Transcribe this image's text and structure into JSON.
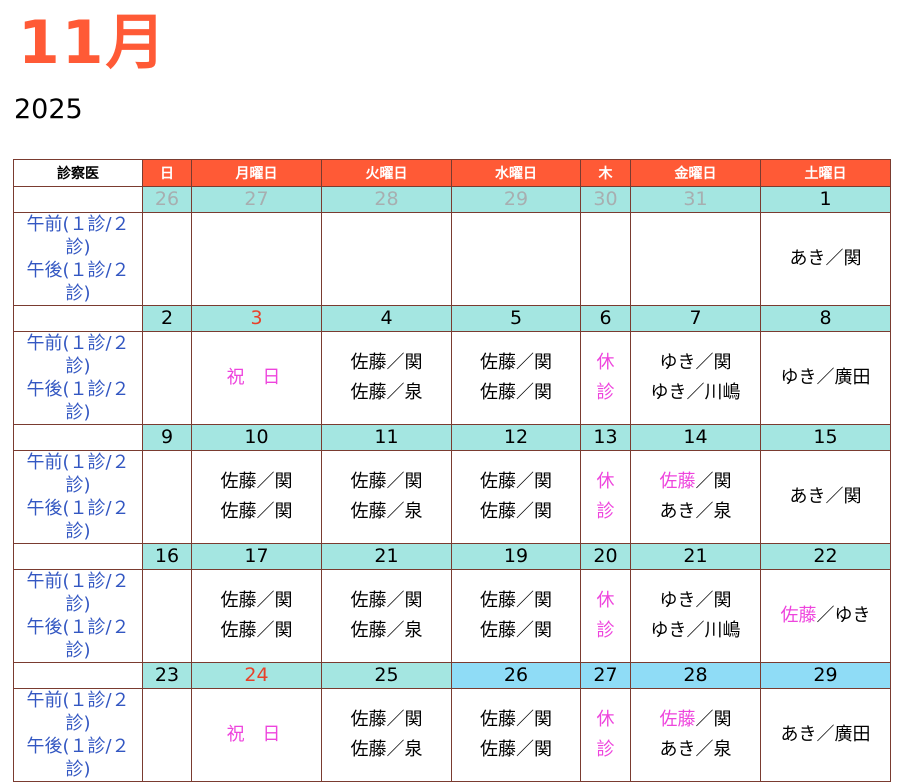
{
  "title": {
    "month": "11月",
    "year": "2025"
  },
  "header": [
    "診察医",
    "日",
    "月曜日",
    "火曜日",
    "水曜日",
    "木",
    "金曜日",
    "土曜日"
  ],
  "row_label": [
    "午前(１診/２診)",
    "午後(１診/２診)"
  ],
  "closed": [
    "休",
    "診"
  ],
  "holiday_text": "祝 日",
  "weeks": [
    {
      "dates": [
        "26",
        "27",
        "28",
        "29",
        "30",
        "31",
        "1"
      ],
      "cells": [
        [],
        [],
        [],
        [],
        [],
        [],
        [
          [
            {
              "t": "あき／関"
            }
          ]
        ]
      ]
    },
    {
      "dates": [
        "2",
        "3",
        "4",
        "5",
        "6",
        "7",
        "8"
      ],
      "cells": [
        [],
        [
          [
            {
              "t": "祝 日",
              "c": "hol"
            }
          ]
        ],
        [
          [
            {
              "t": "佐藤／関"
            }
          ],
          [
            {
              "t": "佐藤／泉"
            }
          ]
        ],
        [
          [
            {
              "t": "佐藤／関"
            }
          ],
          [
            {
              "t": "佐藤／関"
            }
          ]
        ],
        [
          [
            {
              "t": "休",
              "c": "pk"
            }
          ],
          [
            {
              "t": "診",
              "c": "pk"
            }
          ]
        ],
        [
          [
            {
              "t": "ゆき／関"
            }
          ],
          [
            {
              "t": "ゆき／川嶋"
            }
          ]
        ],
        [
          [
            {
              "t": "ゆき／廣田"
            }
          ]
        ]
      ]
    },
    {
      "dates": [
        "9",
        "10",
        "11",
        "12",
        "13",
        "14",
        "15"
      ],
      "cells": [
        [],
        [
          [
            {
              "t": "佐藤／関"
            }
          ],
          [
            {
              "t": "佐藤／関"
            }
          ]
        ],
        [
          [
            {
              "t": "佐藤／関"
            }
          ],
          [
            {
              "t": "佐藤／泉"
            }
          ]
        ],
        [
          [
            {
              "t": "佐藤／関"
            }
          ],
          [
            {
              "t": "佐藤／関"
            }
          ]
        ],
        [
          [
            {
              "t": "休",
              "c": "pk"
            }
          ],
          [
            {
              "t": "診",
              "c": "pk"
            }
          ]
        ],
        [
          [
            {
              "t": "佐藤",
              "c": "pk"
            },
            {
              "t": "／関"
            }
          ],
          [
            {
              "t": "あき／泉"
            }
          ]
        ],
        [
          [
            {
              "t": "あき／関"
            }
          ]
        ]
      ]
    },
    {
      "dates": [
        "16",
        "17",
        "21",
        "19",
        "20",
        "21",
        "22"
      ],
      "cells": [
        [],
        [
          [
            {
              "t": "佐藤／関"
            }
          ],
          [
            {
              "t": "佐藤／関"
            }
          ]
        ],
        [
          [
            {
              "t": "佐藤／関"
            }
          ],
          [
            {
              "t": "佐藤／泉"
            }
          ]
        ],
        [
          [
            {
              "t": "佐藤／関"
            }
          ],
          [
            {
              "t": "佐藤／関"
            }
          ]
        ],
        [
          [
            {
              "t": "休",
              "c": "pk"
            }
          ],
          [
            {
              "t": "診",
              "c": "pk"
            }
          ]
        ],
        [
          [
            {
              "t": "ゆき／関"
            }
          ],
          [
            {
              "t": "ゆき／川嶋"
            }
          ]
        ],
        [
          [
            {
              "t": "佐藤",
              "c": "pk"
            },
            {
              "t": "／ゆき"
            }
          ]
        ]
      ]
    },
    {
      "dates": [
        "23",
        "24",
        "25",
        "26",
        "27",
        "28",
        "29"
      ],
      "cells": [
        [],
        [
          [
            {
              "t": "祝 日",
              "c": "hol"
            }
          ]
        ],
        [
          [
            {
              "t": "佐藤／関"
            }
          ],
          [
            {
              "t": "佐藤／泉"
            }
          ]
        ],
        [
          [
            {
              "t": "佐藤／関"
            }
          ],
          [
            {
              "t": "佐藤／関"
            }
          ]
        ],
        [
          [
            {
              "t": "休",
              "c": "pk"
            }
          ],
          [
            {
              "t": "診",
              "c": "pk"
            }
          ]
        ],
        [
          [
            {
              "t": "佐藤",
              "c": "pk"
            },
            {
              "t": "／関"
            }
          ],
          [
            {
              "t": "あき／泉"
            }
          ]
        ],
        [
          [
            {
              "t": "あき／廣田"
            }
          ]
        ]
      ]
    }
  ],
  "colors": {
    "accent": "#ff5a36",
    "date_row": "#a4e6e1",
    "date_row_alt": "#8fdcf6",
    "prev_month": "#a7aeb0",
    "holiday_date": "#e8412a",
    "pink": "#ee44dd",
    "label_blue": "#3357c2",
    "border": "#7a3b30"
  }
}
